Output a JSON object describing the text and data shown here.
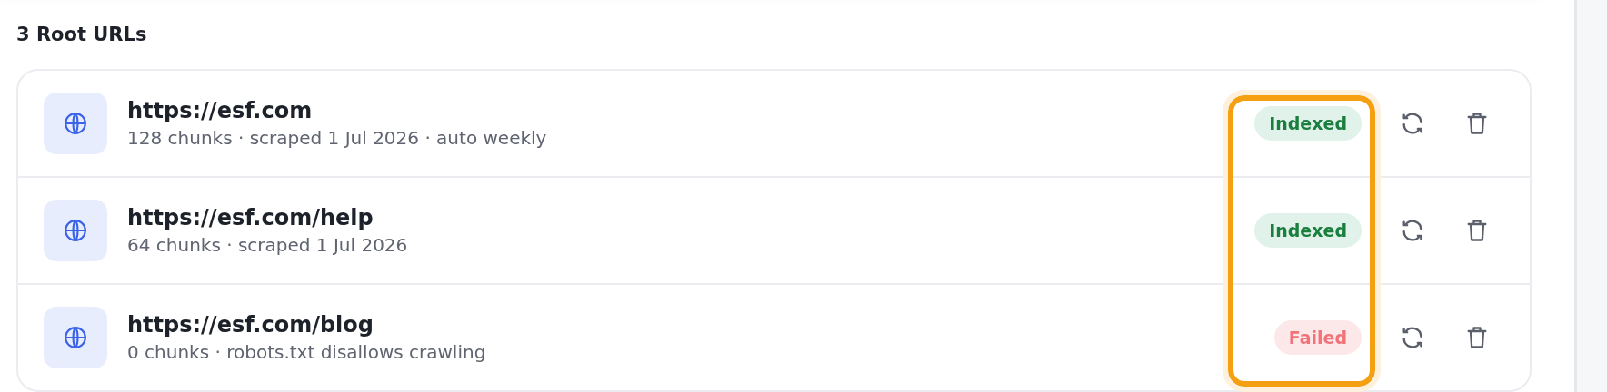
{
  "heading": "3 Root URLs",
  "status_column_highlighted": true,
  "urls": [
    {
      "url": "https://esf.com",
      "meta": "128 chunks · scraped 1 Jul 2026 · auto weekly",
      "status": {
        "kind": "indexed",
        "label": "Indexed"
      }
    },
    {
      "url": "https://esf.com/help",
      "meta": "64 chunks · scraped 1 Jul 2026",
      "status": {
        "kind": "indexed",
        "label": "Indexed"
      }
    },
    {
      "url": "https://esf.com/blog",
      "meta": "0 chunks · robots.txt disallows crawling",
      "status": {
        "kind": "failed",
        "label": "Failed"
      }
    }
  ]
}
